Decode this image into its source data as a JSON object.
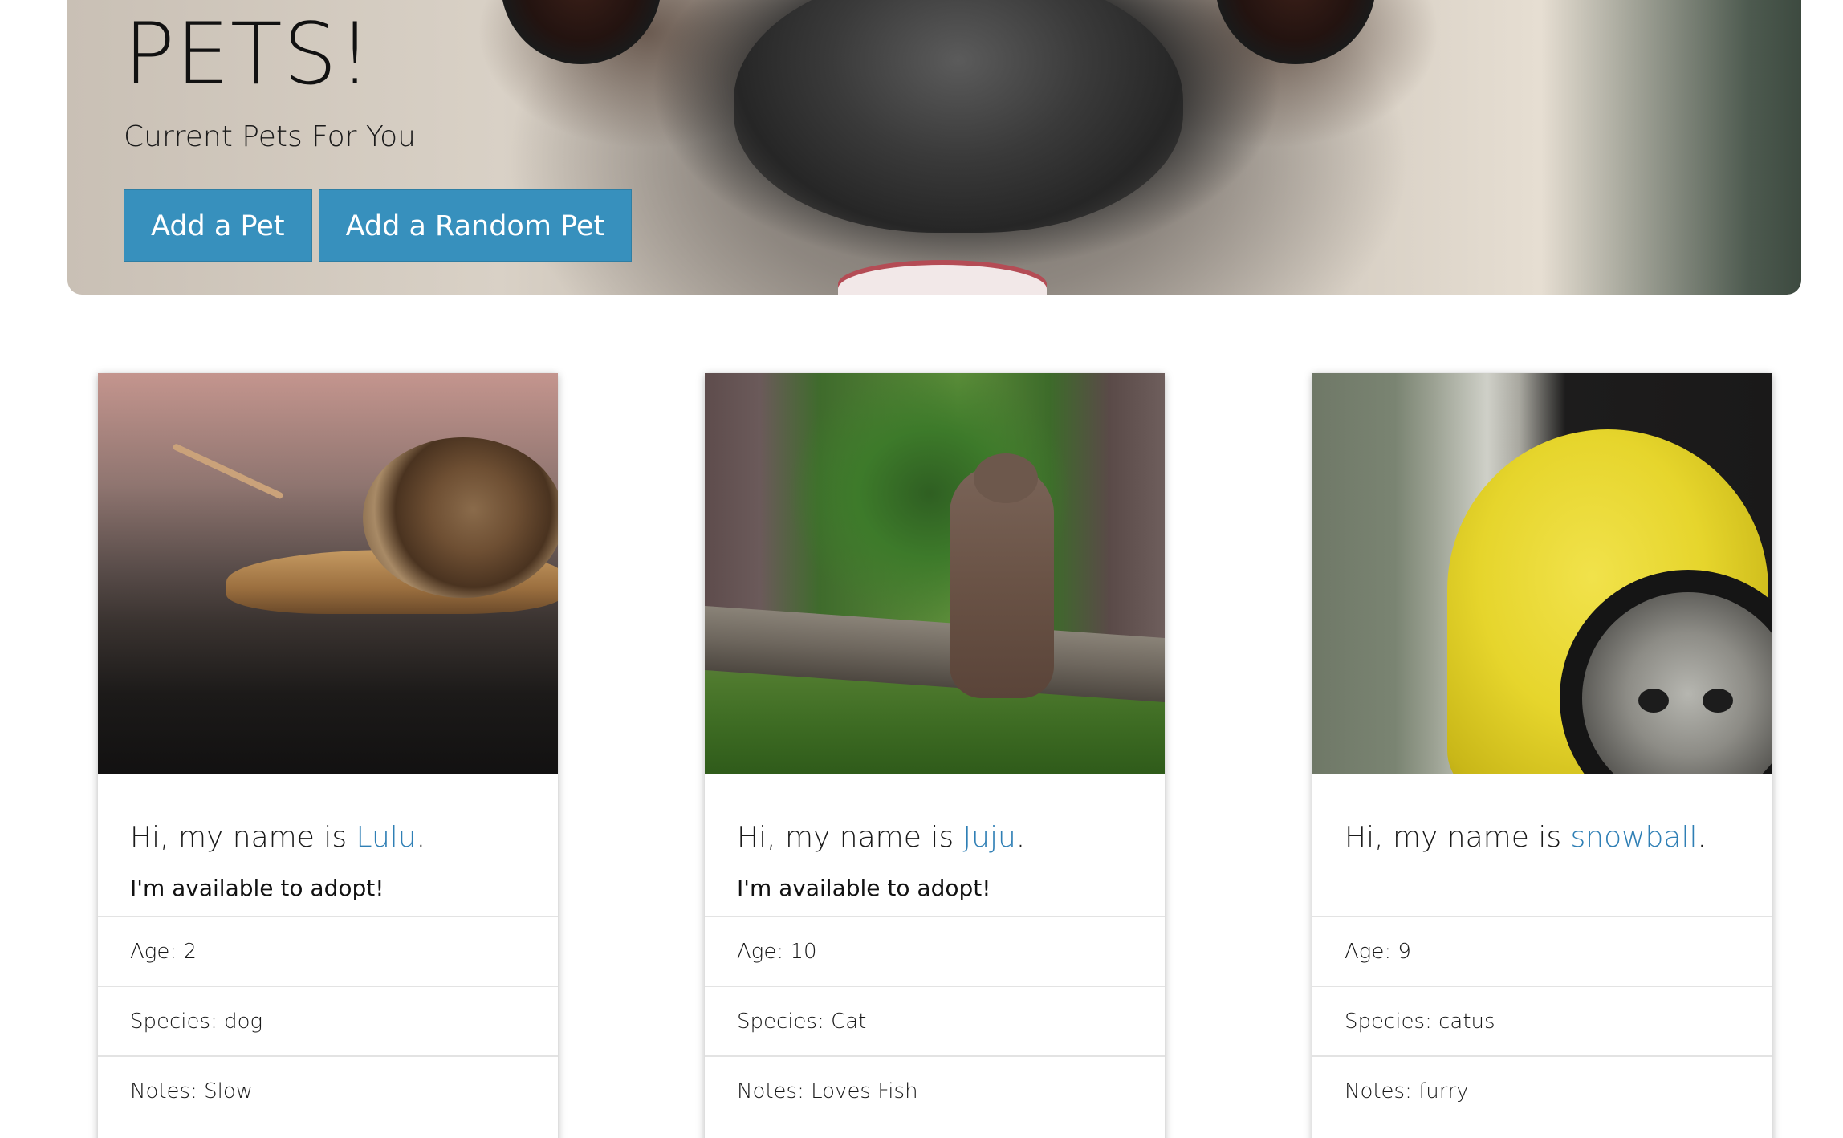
{
  "hero": {
    "title": "PETS!",
    "subtitle": "Current Pets For You",
    "add_pet_label": "Add a Pet",
    "add_random_pet_label": "Add a Random Pet"
  },
  "cards": [
    {
      "greeting_prefix": "Hi, my name is ",
      "name": "Lulu",
      "greeting_suffix": ".",
      "status": "I'm available to adopt!",
      "age": "Age: 2",
      "species": "Species: dog",
      "notes": "Notes: Slow"
    },
    {
      "greeting_prefix": "Hi, my name is ",
      "name": "Juju",
      "greeting_suffix": ".",
      "status": "I'm available to adopt!",
      "age": "Age: 10",
      "species": "Species: Cat",
      "notes": "Notes: Loves Fish"
    },
    {
      "greeting_prefix": "Hi, my name is ",
      "name": "snowball",
      "greeting_suffix": ".",
      "status": "",
      "age": "Age: 9",
      "species": "Species: catus",
      "notes": "Notes: furry"
    }
  ],
  "colors": {
    "button_bg": "#3790bd",
    "link": "#2f7fb5"
  }
}
